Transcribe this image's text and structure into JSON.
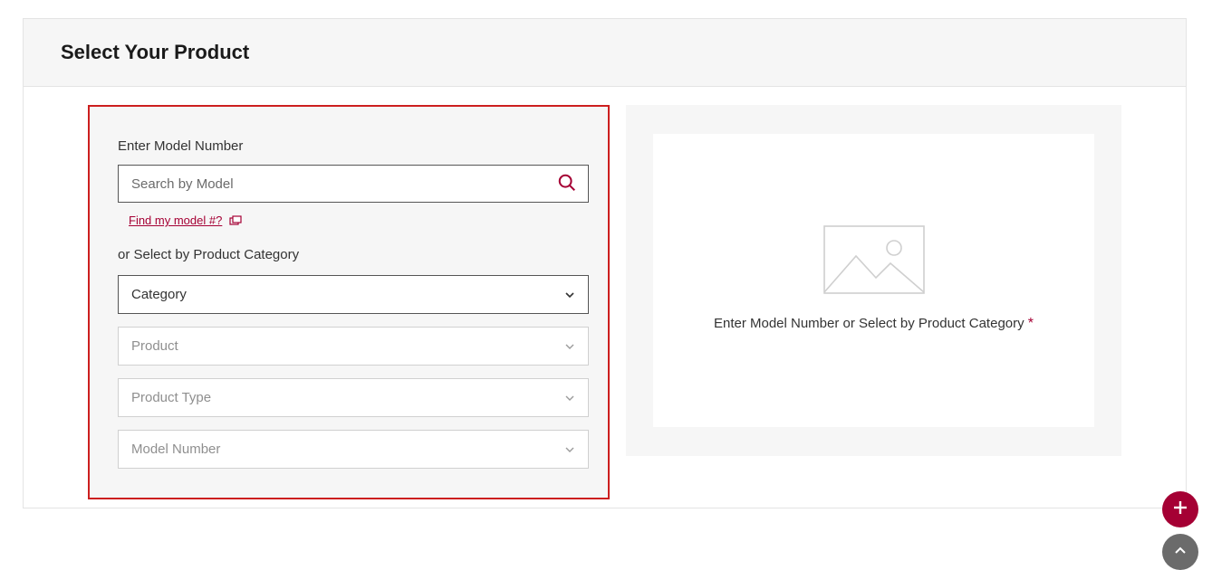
{
  "header": {
    "title": "Select Your Product"
  },
  "left": {
    "enter_label": "Enter Model Number",
    "search_placeholder": "Search by Model",
    "find_link": "Find my model #?",
    "or_label": "or Select by Product Category",
    "selects": {
      "category": "Category",
      "product": "Product",
      "product_type": "Product Type",
      "model_number": "Model Number"
    }
  },
  "right": {
    "hint": "Enter Model Number or Select by Product Category",
    "required_marker": "*"
  },
  "colors": {
    "accent": "#a50034",
    "highlight_border": "#cc1f1f"
  }
}
